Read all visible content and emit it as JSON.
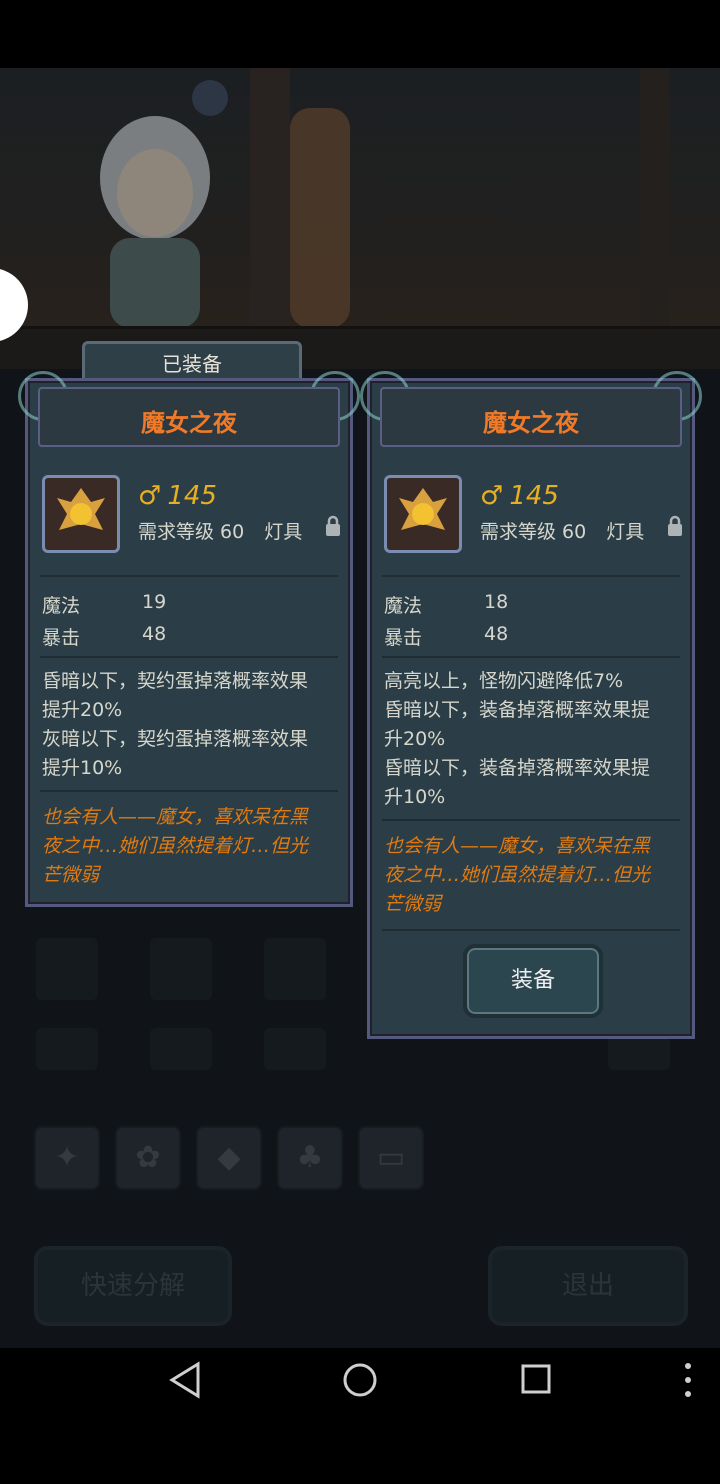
{
  "equipped_tag": "已装备",
  "cards": [
    {
      "title": "魔女之夜",
      "power": "145",
      "requirement": "需求等级 60",
      "type": "灯具",
      "stats": [
        {
          "name": "魔法",
          "value": "19"
        },
        {
          "name": "暴击",
          "value": "48"
        }
      ],
      "effects": [
        "昏暗以下，契约蛋掉落概率效果",
        "提升20%",
        "灰暗以下，契约蛋掉落概率效果",
        "提升10%"
      ],
      "lore": [
        "也会有人——魔女，喜欢呆在黑",
        "夜之中…她们虽然提着灯…但光",
        "芒微弱"
      ]
    },
    {
      "title": "魔女之夜",
      "power": "145",
      "requirement": "需求等级 60",
      "type": "灯具",
      "stats": [
        {
          "name": "魔法",
          "value": "18"
        },
        {
          "name": "暴击",
          "value": "48"
        }
      ],
      "effects": [
        "高亮以上，怪物闪避降低7%",
        "昏暗以下，装备掉落概率效果提",
        "升20%",
        "昏暗以下，装备掉落概率效果提",
        "升10%"
      ],
      "lore": [
        "也会有人——魔女，喜欢呆在黑",
        "夜之中…她们虽然提着灯…但光",
        "芒微弱"
      ],
      "equip_label": "装备"
    }
  ],
  "bottom": {
    "quick_decompose": "快速分解",
    "exit": "退出"
  },
  "icons": {
    "power": "power-icon",
    "lock": "lock-icon",
    "item": "lamp-item-icon"
  },
  "colors": {
    "title": "#f07a28",
    "power": "#e8b020",
    "lore": "#e07a10"
  }
}
